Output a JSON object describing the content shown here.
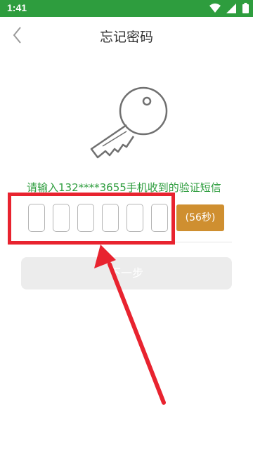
{
  "status_bar": {
    "time": "1:41"
  },
  "header": {
    "title": "忘记密码"
  },
  "verification": {
    "hint": "请输入132****3655手机收到的验证短信",
    "countdown": "(56秒)",
    "code_digits": [
      "",
      "",
      "",
      "",
      "",
      ""
    ]
  },
  "actions": {
    "next_label": "下一步"
  },
  "colors": {
    "accent": "#2e9d3e",
    "countdown_bg": "#cf8f30",
    "annotation": "#e8232f"
  },
  "icons": [
    "back-arrow-icon",
    "wifi-icon",
    "signal-icon",
    "battery-icon",
    "key-icon"
  ]
}
